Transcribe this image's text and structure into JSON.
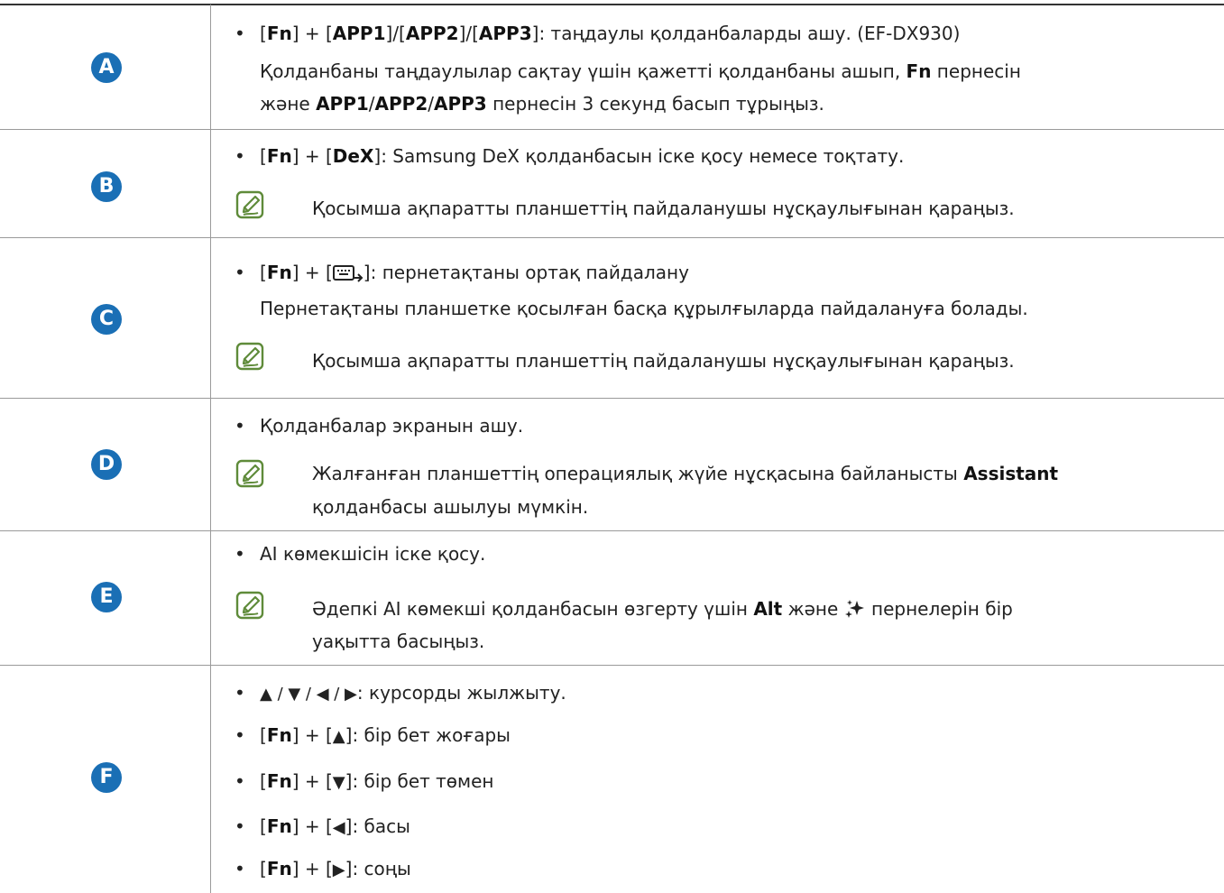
{
  "rows": [
    {
      "badge": "A",
      "b1": {
        "k1": "Fn",
        "k2": "APP1",
        "k3": "APP2",
        "k4": "APP3",
        "desc": ": таңдаулы қолданбаларды ашу. (EF-DX930)"
      },
      "p1": {
        "pre": "Қолданбаны таңдаулылар сақтау үшін қажетті қолданбаны ашып, ",
        "k": "Fn",
        "post": " пернесін"
      },
      "p2": {
        "pre": "және ",
        "k1": "APP1",
        "k2": "APP2",
        "k3": "APP3",
        "post": " пернесін 3 секунд басып тұрыңыз."
      }
    },
    {
      "badge": "B",
      "b1": {
        "k1": "Fn",
        "k2": "DeX",
        "desc": ": Samsung DeX қолданбасын іске қосу немесе тоқтату."
      },
      "note": "Қосымша ақпаратты планшеттің пайдаланушы нұсқаулығынан қараңыз."
    },
    {
      "badge": "C",
      "b1": {
        "k1": "Fn",
        "desc": ": пернетақтаны ортақ пайдалану"
      },
      "p1": "Пернетақтаны планшетке қосылған басқа құрылғыларда пайдалануға болады.",
      "note": "Қосымша ақпаратты планшеттің пайдаланушы нұсқаулығынан қараңыз."
    },
    {
      "badge": "D",
      "b1": "Қолданбалар экранын ашу.",
      "note1": {
        "pre": "Жалғанған планшеттің операциялық жүйе нұсқасына байланысты ",
        "k": "Assistant"
      },
      "note2": "қолданбасы ашылуы мүмкін."
    },
    {
      "badge": "E",
      "b1": "AI көмекшісін іске қосу.",
      "note1": {
        "pre": "Әдепкі AI көмекші қолданбасын өзгерту үшін ",
        "k": "Alt",
        "mid": " және ",
        "post": " пернелерін бір"
      },
      "note2": "уақытта басыңыз."
    },
    {
      "badge": "F",
      "b1": {
        "arrows": "▲ / ▼ / ◀ / ▶",
        "desc": ": курсорды жылжыту."
      },
      "b2": {
        "k1": "Fn",
        "k2": "▲",
        "desc": ": бір бет жоғары"
      },
      "b3": {
        "k1": "Fn",
        "k2": "▼",
        "desc": ": бір бет төмен"
      },
      "b4": {
        "k1": "Fn",
        "k2": "◀",
        "desc": ": басы"
      },
      "b5": {
        "k1": "Fn",
        "k2": "▶",
        "desc": ": соңы"
      }
    }
  ],
  "colors": {
    "badge": "#1a6fb5",
    "note_icon": "#5f8b3a",
    "rule": "#333333",
    "divider": "#9a9a9a"
  }
}
